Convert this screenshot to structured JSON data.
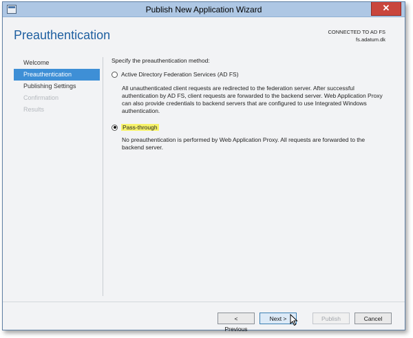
{
  "window": {
    "title": "Publish New Application Wizard",
    "close_glyph": "✕"
  },
  "header": {
    "page_title": "Preauthentication",
    "connection_line1": "CONNECTED TO AD FS",
    "connection_line2": "fs.adatum.dk"
  },
  "sidebar": {
    "items": [
      {
        "label": "Welcome",
        "state": "normal"
      },
      {
        "label": "Preauthentication",
        "state": "active"
      },
      {
        "label": "Publishing Settings",
        "state": "normal"
      },
      {
        "label": "Confirmation",
        "state": "disabled"
      },
      {
        "label": "Results",
        "state": "disabled"
      }
    ]
  },
  "main": {
    "prompt": "Specify the preauthentication method:",
    "options": [
      {
        "label": "Active Directory Federation Services (AD FS)",
        "checked": false,
        "description_lines": [
          "All unauthenticated client requests are redirected to the federation server. After successful",
          "authentication by AD FS, client requests are forwarded to the backend server. Web Application Proxy",
          "can also provide credentials to backend servers that are configured to use Integrated Windows",
          "authentication."
        ]
      },
      {
        "label": "Pass-through",
        "checked": true,
        "highlighted": true,
        "description_lines": [
          "No preauthentication is performed by Web Application Proxy. All requests are forwarded to the",
          "backend server."
        ]
      }
    ]
  },
  "footer": {
    "previous_label": "< Previous",
    "next_label": "Next >",
    "publish_label": "Publish",
    "cancel_label": "Cancel"
  },
  "colors": {
    "accent": "#3e8fd6",
    "heading": "#1e5fa0",
    "titlebar": "#aec7e4",
    "close": "#c9463d",
    "highlight": "#f7f36a"
  }
}
